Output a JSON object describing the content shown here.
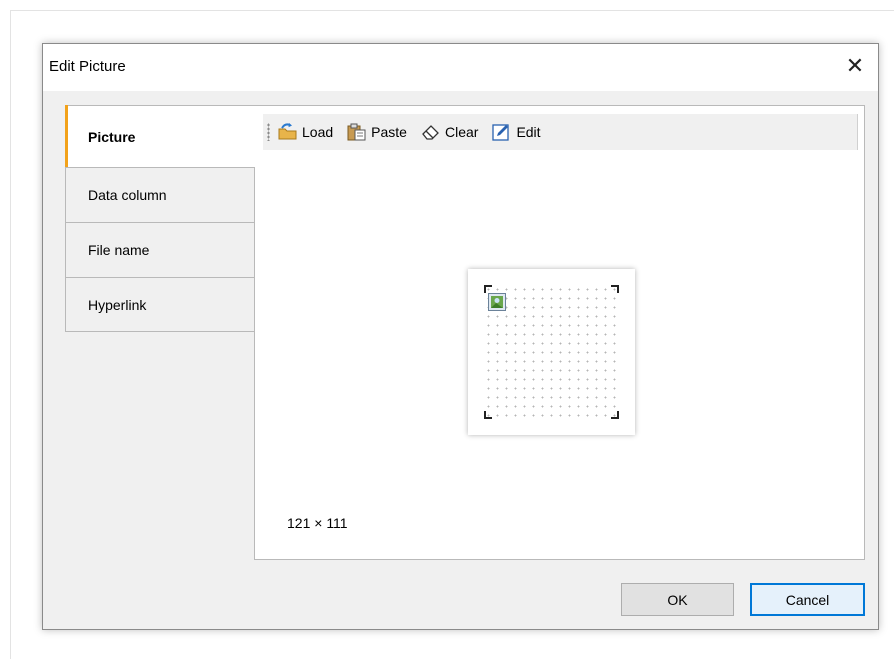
{
  "dialog": {
    "title": "Edit Picture",
    "close_glyph": "✕"
  },
  "tabs": [
    {
      "label": "Picture",
      "active": true
    },
    {
      "label": "Data column",
      "active": false
    },
    {
      "label": "File name",
      "active": false
    },
    {
      "label": "Hyperlink",
      "active": false
    }
  ],
  "toolbar": {
    "load_label": "Load",
    "paste_label": "Paste",
    "clear_label": "Clear",
    "edit_label": "Edit"
  },
  "preview": {
    "dimensions": "121 × 111"
  },
  "buttons": {
    "ok_label": "OK",
    "cancel_label": "Cancel"
  },
  "colors": {
    "active_tab_accent": "#f2a21b",
    "default_button_border": "#0078d7"
  }
}
